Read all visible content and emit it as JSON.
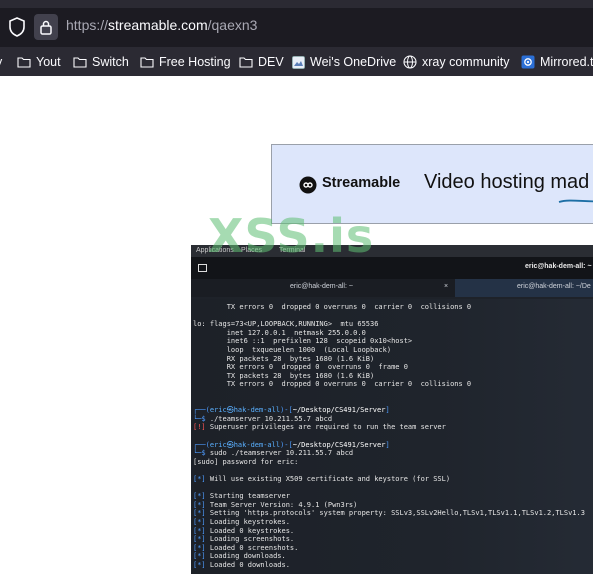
{
  "browser": {
    "url_scheme": "https://",
    "url_host": "streamable.com",
    "url_path": "/qaexn3",
    "bookmarks": [
      {
        "label": "y",
        "icon": "folder-icon"
      },
      {
        "label": "Yout",
        "icon": "folder-icon"
      },
      {
        "label": "Switch",
        "icon": "folder-icon"
      },
      {
        "label": "Free Hosting",
        "icon": "folder-icon"
      },
      {
        "label": "DEV",
        "icon": "folder-icon"
      },
      {
        "label": "Wei's OneDrive",
        "icon": "page-icon"
      },
      {
        "label": "xray community",
        "icon": "globe-icon"
      },
      {
        "label": "Mirrored.t",
        "icon": "app-icon"
      }
    ]
  },
  "banner": {
    "brand": "Streamable",
    "tagline": "Video hosting mad"
  },
  "watermark": "XSS.is",
  "screenshot": {
    "top_bar": {
      "applications": "Applications",
      "places": "Places",
      "terminal": "Terminal"
    },
    "window_title": "eric@hak-dem-all: ~",
    "tabs": [
      {
        "label": "eric@hak-dem-all: ~"
      },
      {
        "label": "eric@hak-dem-all: ~/De"
      }
    ],
    "tab_close": "×",
    "lines": [
      {
        "parts": [
          {
            "t": "        TX errors 0  dropped 0 overruns 0  carrier 0  collisions 0",
            "c": ""
          }
        ]
      },
      {
        "parts": [
          {
            "t": "",
            "c": ""
          }
        ]
      },
      {
        "parts": [
          {
            "t": "lo: flags=73<UP,LOOPBACK,RUNNING>  mtu 65536",
            "c": ""
          }
        ]
      },
      {
        "parts": [
          {
            "t": "        inet 127.0.0.1  netmask 255.0.0.0",
            "c": ""
          }
        ]
      },
      {
        "parts": [
          {
            "t": "        inet6 ::1  prefixlen 128  scopeid 0x10<host>",
            "c": ""
          }
        ]
      },
      {
        "parts": [
          {
            "t": "        loop  txqueuelen 1000  (Local Loopback)",
            "c": ""
          }
        ]
      },
      {
        "parts": [
          {
            "t": "        RX packets 28  bytes 1680 (1.6 KiB)",
            "c": ""
          }
        ]
      },
      {
        "parts": [
          {
            "t": "        RX errors 0  dropped 0  overruns 0  frame 0",
            "c": ""
          }
        ]
      },
      {
        "parts": [
          {
            "t": "        TX packets 28  bytes 1680 (1.6 KiB)",
            "c": ""
          }
        ]
      },
      {
        "parts": [
          {
            "t": "        TX errors 0  dropped 0 overruns 0  carrier 0  collisions 0",
            "c": ""
          }
        ]
      },
      {
        "parts": [
          {
            "t": "",
            "c": ""
          }
        ]
      },
      {
        "parts": [
          {
            "t": "",
            "c": ""
          }
        ]
      },
      {
        "parts": [
          {
            "t": "┌──(",
            "c": "c-blue"
          },
          {
            "t": "eric㉿hak-dem-all",
            "c": "c-cyan"
          },
          {
            "t": ")-[",
            "c": "c-blue"
          },
          {
            "t": "~/Desktop/CS491/Server",
            "c": "c-white"
          },
          {
            "t": "]",
            "c": "c-blue"
          }
        ]
      },
      {
        "parts": [
          {
            "t": "└─$ ",
            "c": "c-blue"
          },
          {
            "t": "./teamserver 10.211.55.7 abcd",
            "c": ""
          }
        ]
      },
      {
        "parts": [
          {
            "t": "[!] ",
            "c": "c-red"
          },
          {
            "t": "Superuser privileges are required to run the team server",
            "c": ""
          }
        ]
      },
      {
        "parts": [
          {
            "t": "",
            "c": ""
          }
        ]
      },
      {
        "parts": [
          {
            "t": "┌──(",
            "c": "c-blue"
          },
          {
            "t": "eric㉿hak-dem-all",
            "c": "c-cyan"
          },
          {
            "t": ")-[",
            "c": "c-blue"
          },
          {
            "t": "~/Desktop/CS491/Server",
            "c": "c-white"
          },
          {
            "t": "]",
            "c": "c-blue"
          }
        ]
      },
      {
        "parts": [
          {
            "t": "└─$ ",
            "c": "c-blue"
          },
          {
            "t": "sudo ./teamserver 10.211.55.7 abcd",
            "c": ""
          }
        ]
      },
      {
        "parts": [
          {
            "t": "[sudo] password for eric:",
            "c": ""
          }
        ]
      },
      {
        "parts": [
          {
            "t": "",
            "c": ""
          }
        ]
      },
      {
        "parts": [
          {
            "t": "[*] ",
            "c": "c-blue"
          },
          {
            "t": "Will use existing X509 certificate and keystore (for SSL)",
            "c": ""
          }
        ]
      },
      {
        "parts": [
          {
            "t": "",
            "c": ""
          }
        ]
      },
      {
        "parts": [
          {
            "t": "[*] ",
            "c": "c-blue"
          },
          {
            "t": "Starting teamserver",
            "c": ""
          }
        ]
      },
      {
        "parts": [
          {
            "t": "[*] ",
            "c": "c-blue"
          },
          {
            "t": "Team Server Version: 4.9.1 (Pwn3rs)",
            "c": ""
          }
        ]
      },
      {
        "parts": [
          {
            "t": "[*] ",
            "c": "c-blue"
          },
          {
            "t": "Setting 'https.protocols' system property: SSLv3,SSLv2Hello,TLSv1,TLSv1.1,TLSv1.2,TLSv1.3",
            "c": ""
          }
        ]
      },
      {
        "parts": [
          {
            "t": "[*] ",
            "c": "c-blue"
          },
          {
            "t": "Loading keystrokes.",
            "c": ""
          }
        ]
      },
      {
        "parts": [
          {
            "t": "[*] ",
            "c": "c-blue"
          },
          {
            "t": "Loaded 0 keystrokes.",
            "c": ""
          }
        ]
      },
      {
        "parts": [
          {
            "t": "[*] ",
            "c": "c-blue"
          },
          {
            "t": "Loading screenshots.",
            "c": ""
          }
        ]
      },
      {
        "parts": [
          {
            "t": "[*] ",
            "c": "c-blue"
          },
          {
            "t": "Loaded 0 screenshots.",
            "c": ""
          }
        ]
      },
      {
        "parts": [
          {
            "t": "[*] ",
            "c": "c-blue"
          },
          {
            "t": "Loading downloads.",
            "c": ""
          }
        ]
      },
      {
        "parts": [
          {
            "t": "[*] ",
            "c": "c-blue"
          },
          {
            "t": "Loaded 0 downloads.",
            "c": ""
          }
        ]
      }
    ]
  }
}
